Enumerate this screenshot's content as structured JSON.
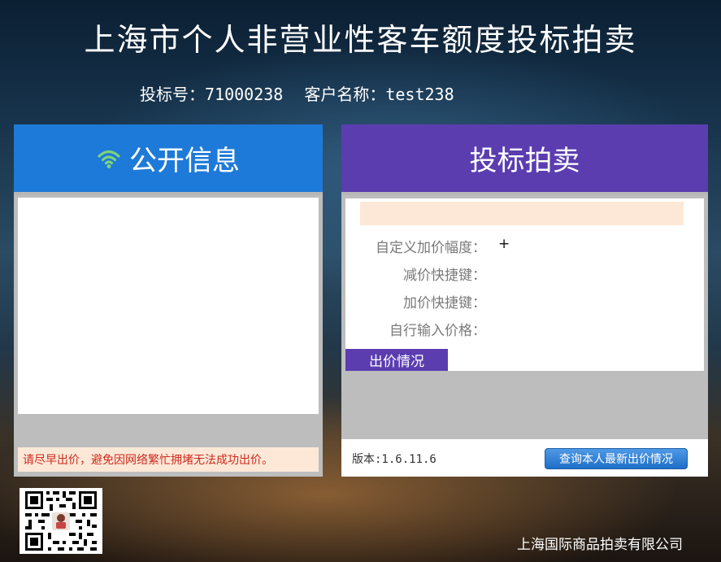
{
  "page": {
    "title": "上海市个人非营业性客车额度投标拍卖",
    "bid_number_label": "投标号：",
    "bid_number": "71000238",
    "customer_name_label": "客户名称：",
    "customer_name": "test238"
  },
  "public_info": {
    "header": "公开信息",
    "icon": "wifi-icon",
    "notice": "请尽早出价，避免因网络繁忙拥堵无法成功出价。"
  },
  "auction": {
    "header": "投标拍卖",
    "fields": [
      {
        "label": "自定义加价幅度：",
        "value": "+"
      },
      {
        "label": "减价快捷键：",
        "value": ""
      },
      {
        "label": "加价快捷键：",
        "value": ""
      },
      {
        "label": "自行输入价格：",
        "value": ""
      }
    ],
    "bid_status_tab": "出价情况",
    "version": "版本:1.6.11.6",
    "query_button": "查询本人最新出价情况"
  },
  "footer": {
    "company": "上海国际商品拍卖有限公司"
  },
  "colors": {
    "left_header": "#1e7ad8",
    "right_header": "#5b3db0",
    "notice_text": "#cc2a1e",
    "notice_bg": "#fde8d7",
    "wifi_icon": "#7ed37b"
  }
}
